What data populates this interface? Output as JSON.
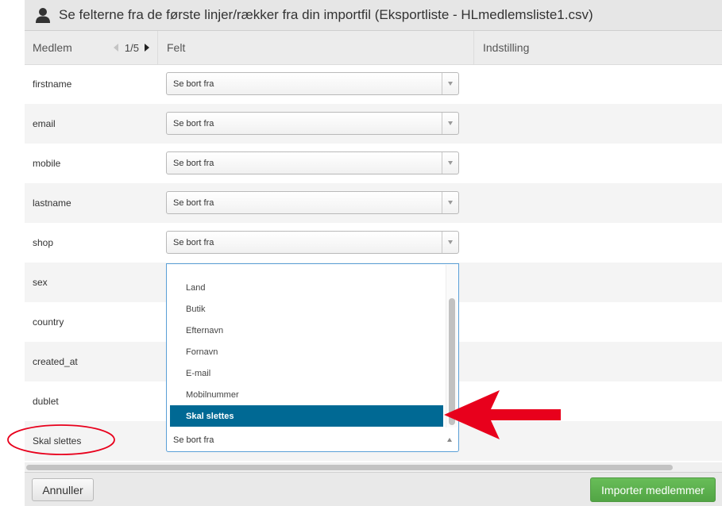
{
  "dialog": {
    "title": "Se felterne fra de første linjer/rækker fra din importfil (Eksportliste - HLmedlemsliste1.csv)",
    "icon": "user-icon"
  },
  "table_header": {
    "medlem": "Medlem",
    "pager": "1/5",
    "felt": "Felt",
    "indstilling": "Indstilling"
  },
  "rows": [
    {
      "name": "firstname",
      "select": "Se bort fra"
    },
    {
      "name": "email",
      "select": "Se bort fra"
    },
    {
      "name": "mobile",
      "select": "Se bort fra"
    },
    {
      "name": "lastname",
      "select": "Se bort fra"
    },
    {
      "name": "shop",
      "select": "Se bort fra"
    },
    {
      "name": "sex"
    },
    {
      "name": "country"
    },
    {
      "name": "created_at"
    },
    {
      "name": "dublet"
    },
    {
      "name": "Skal slettes",
      "select": "Se bort fra"
    }
  ],
  "dropdown": {
    "options": [
      "Land",
      "Butik",
      "Efternavn",
      "Fornavn",
      "E-mail",
      "Mobilnummer",
      "Skal slettes"
    ],
    "highlighted": "Skal slettes"
  },
  "footer": {
    "cancel": "Annuller",
    "import": "Importer medlemmer"
  },
  "colors": {
    "highlight": "#006994",
    "import_button": "#5cb14d",
    "annotation": "#e8001c"
  }
}
